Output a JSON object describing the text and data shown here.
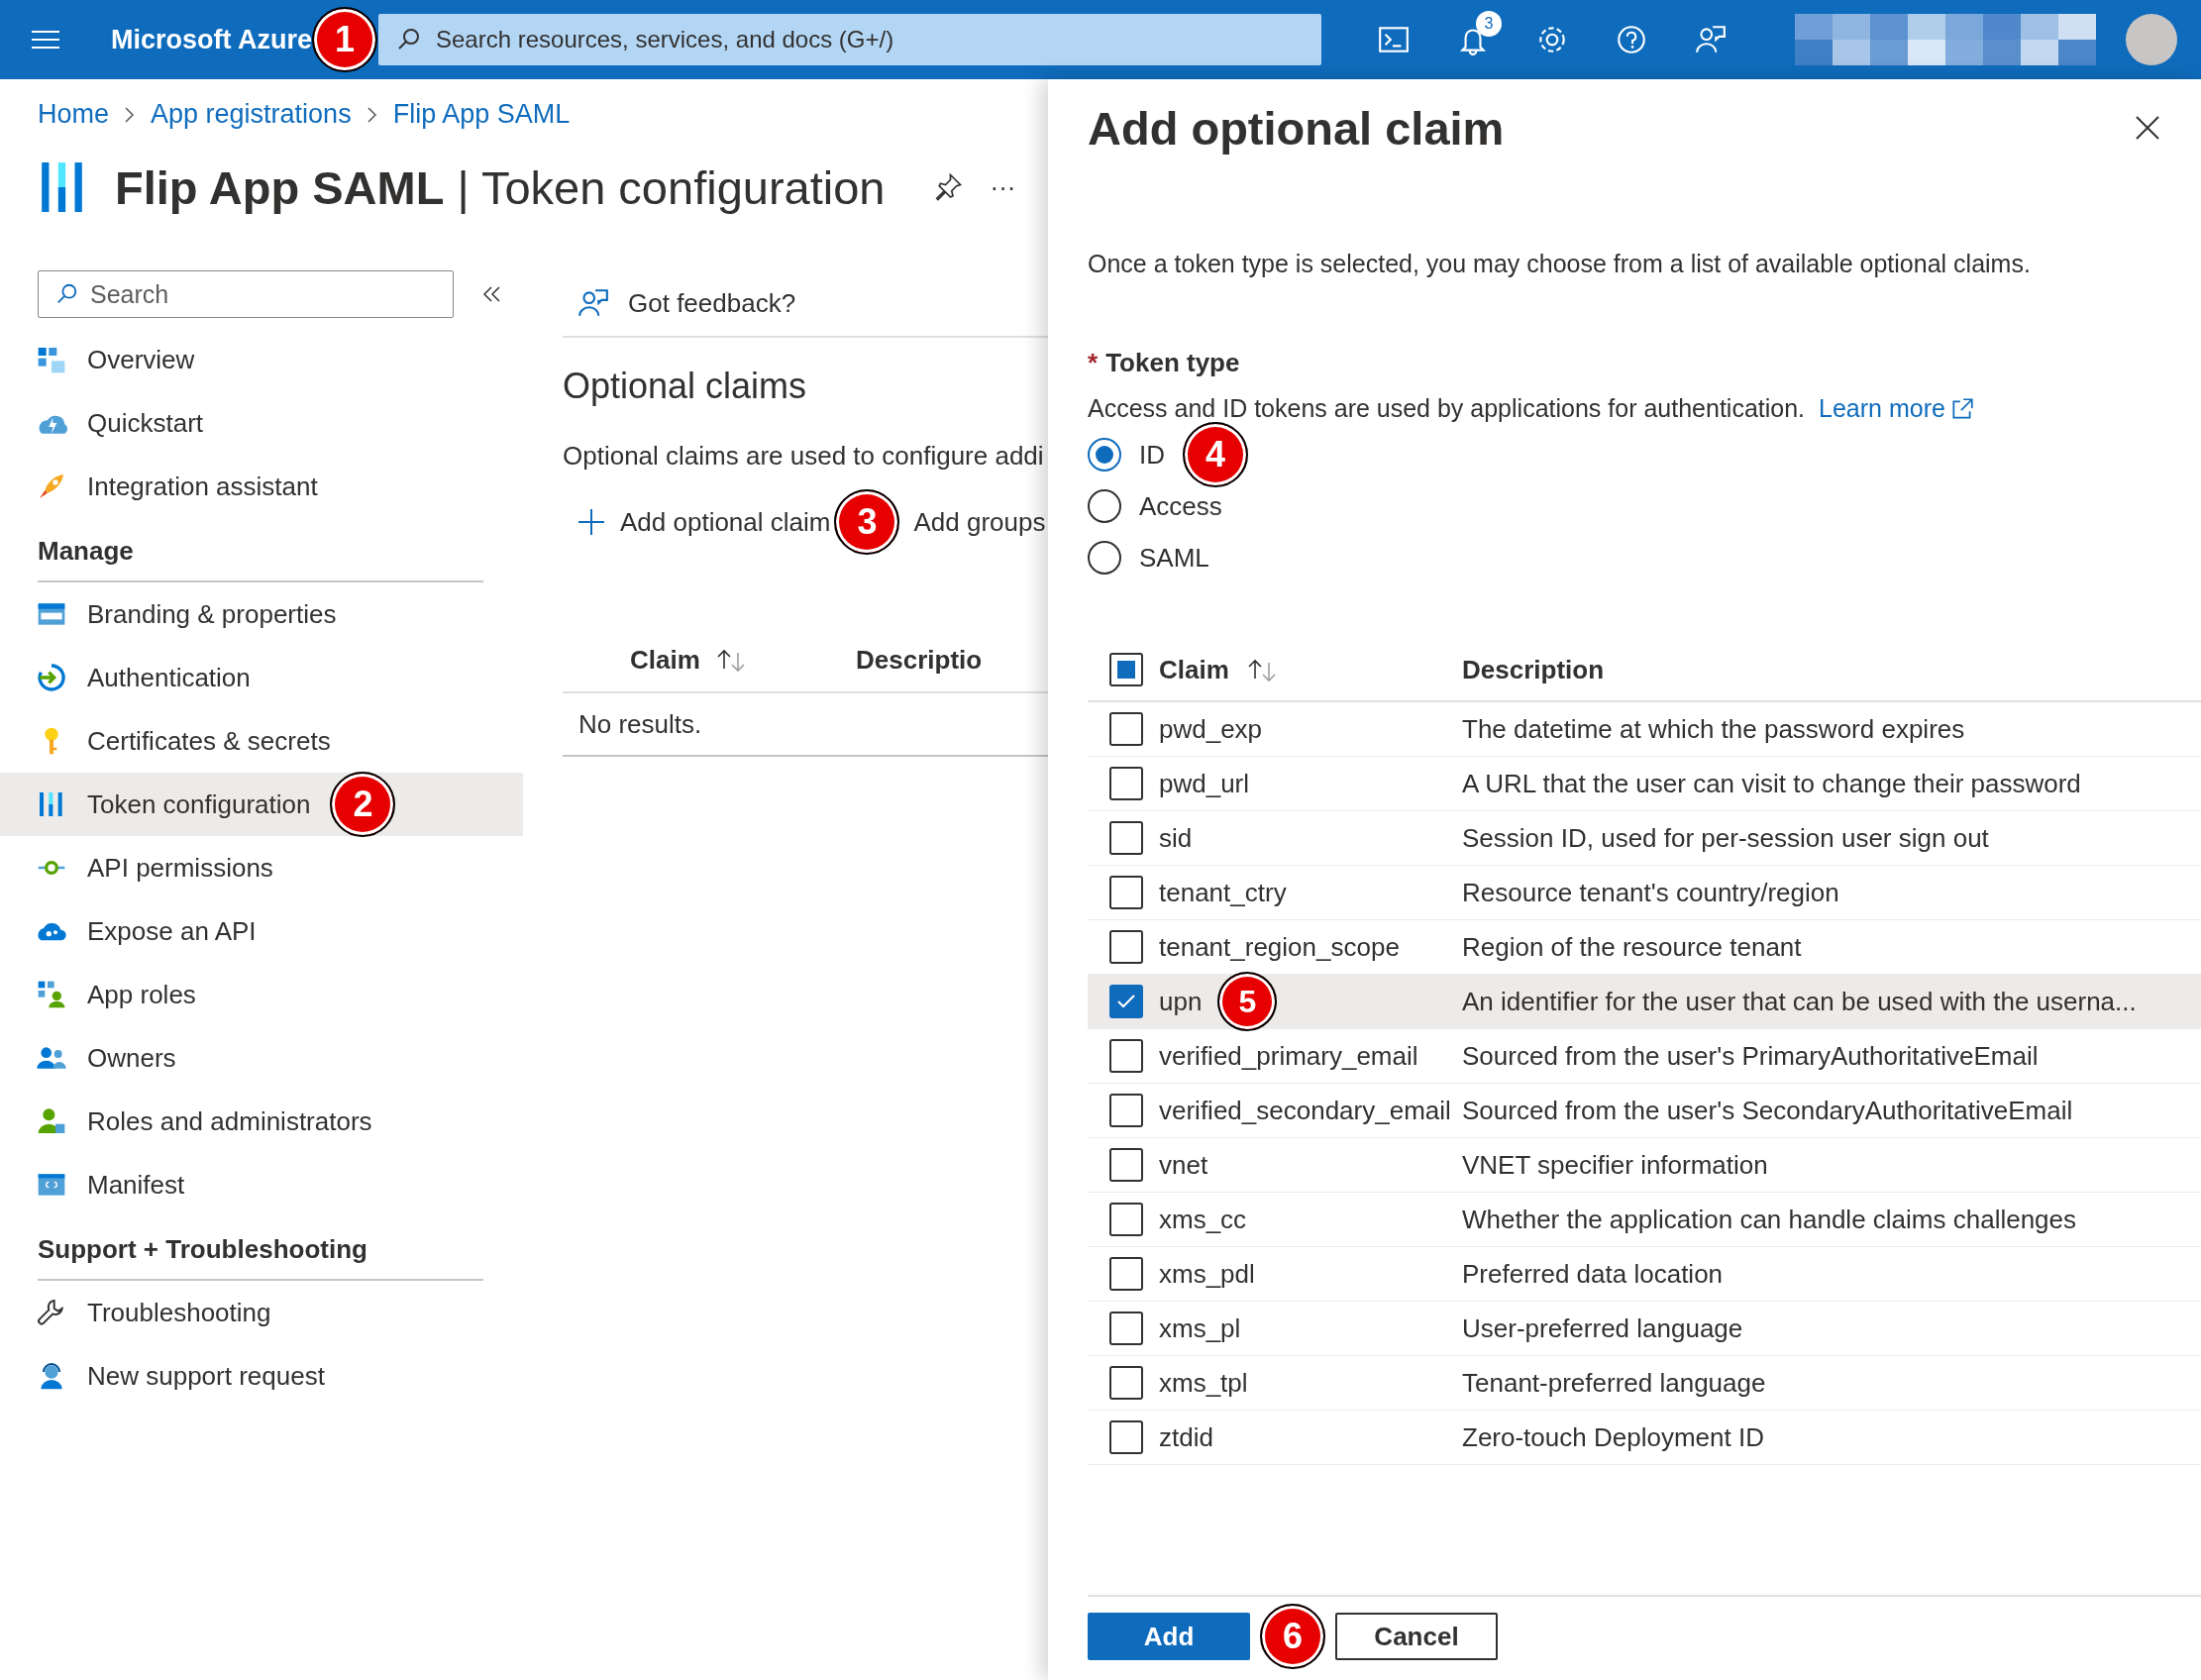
{
  "top_bar": {
    "brand": "Microsoft Azure",
    "brand_badge": "1",
    "search_placeholder": "Search resources, services, and docs (G+/)",
    "notification_count": "3"
  },
  "breadcrumbs": [
    "Home",
    "App registrations",
    "Flip App SAML"
  ],
  "page": {
    "title": "**Flip App SAML** | Token configuration",
    "more": "···"
  },
  "sidebar": {
    "search_placeholder": "Search",
    "sections": [
      {
        "items": [
          {
            "label": "Overview",
            "kind": "overview",
            "selected": false
          },
          {
            "label": "Quickstart",
            "kind": "quickstart",
            "selected": false
          },
          {
            "label": "Integration assistant",
            "kind": "rocket",
            "selected": false
          }
        ]
      },
      {
        "heading": "Manage",
        "items": [
          {
            "label": "Branding & properties",
            "kind": "branding",
            "selected": false
          },
          {
            "label": "Authentication",
            "kind": "auth",
            "selected": false
          },
          {
            "label": "Certificates & secrets",
            "kind": "key",
            "selected": false
          },
          {
            "label": "Token configuration",
            "kind": "token",
            "selected": true,
            "badge": "2"
          },
          {
            "label": "API permissions",
            "kind": "api",
            "selected": false
          },
          {
            "label": "Expose an API",
            "kind": "cloud",
            "selected": false
          },
          {
            "label": "App roles",
            "kind": "roles",
            "selected": false
          },
          {
            "label": "Owners",
            "kind": "owners",
            "selected": false
          },
          {
            "label": "Roles and administrators",
            "kind": "admins",
            "selected": false
          },
          {
            "label": "Manifest",
            "kind": "manifest",
            "selected": false
          }
        ]
      },
      {
        "heading": "Support + Troubleshooting",
        "items": [
          {
            "label": "Troubleshooting",
            "kind": "wrench",
            "selected": false
          },
          {
            "label": "New support request",
            "kind": "support",
            "selected": false
          }
        ]
      }
    ]
  },
  "main": {
    "feedback": "Got feedback?",
    "heading": "Optional claims",
    "description": "Optional claims are used to configure addi",
    "actions": [
      {
        "label": "Add optional claim",
        "kind": "add",
        "badge": "3"
      },
      {
        "label": "Add groups",
        "kind": "plain"
      }
    ],
    "columns": [
      "Claim",
      "Descriptio"
    ],
    "empty": "No results."
  },
  "panel": {
    "title": "Add optional claim",
    "description": "Once a token type is selected, you may choose from a list of available optional claims.",
    "token_type": {
      "label": "Token type",
      "required_mark": "*",
      "help": "Access and ID tokens are used by applications for authentication.",
      "link": "Learn more",
      "options": [
        {
          "label": "ID",
          "selected": true,
          "badge": "4"
        },
        {
          "label": "Access",
          "selected": false
        },
        {
          "label": "SAML",
          "selected": false
        }
      ]
    },
    "columns": [
      "Claim",
      "Description"
    ],
    "select_all_partial": true,
    "claims": [
      {
        "name": "pwd_exp",
        "description": "The datetime at which the password expires",
        "checked": false,
        "selected": false
      },
      {
        "name": "pwd_url",
        "description": "A URL that the user can visit to change their password",
        "checked": false,
        "selected": false
      },
      {
        "name": "sid",
        "description": "Session ID, used for per-session user sign out",
        "checked": false,
        "selected": false
      },
      {
        "name": "tenant_ctry",
        "description": "Resource tenant's country/region",
        "checked": false,
        "selected": false
      },
      {
        "name": "tenant_region_scope",
        "description": "Region of the resource tenant",
        "checked": false,
        "selected": false
      },
      {
        "name": "upn",
        "description": "An identifier for the user that can be used with the userna...",
        "checked": true,
        "selected": true,
        "badge": "5"
      },
      {
        "name": "verified_primary_email",
        "description": "Sourced from the user's PrimaryAuthoritativeEmail",
        "checked": false,
        "selected": false
      },
      {
        "name": "verified_secondary_email",
        "description": "Sourced from the user's SecondaryAuthoritativeEmail",
        "checked": false,
        "selected": false
      },
      {
        "name": "vnet",
        "description": "VNET specifier information",
        "checked": false,
        "selected": false
      },
      {
        "name": "xms_cc",
        "description": "Whether the application can handle claims challenges",
        "checked": false,
        "selected": false
      },
      {
        "name": "xms_pdl",
        "description": "Preferred data location",
        "checked": false,
        "selected": false
      },
      {
        "name": "xms_pl",
        "description": "User-preferred language",
        "checked": false,
        "selected": false
      },
      {
        "name": "xms_tpl",
        "description": "Tenant-preferred language",
        "checked": false,
        "selected": false
      },
      {
        "name": "ztdid",
        "description": "Zero-touch Deployment ID",
        "checked": false,
        "selected": false
      }
    ],
    "buttons": [
      {
        "label": "Add",
        "kind": "primary",
        "badge": "6"
      },
      {
        "label": "Cancel",
        "kind": "secondary"
      }
    ]
  }
}
